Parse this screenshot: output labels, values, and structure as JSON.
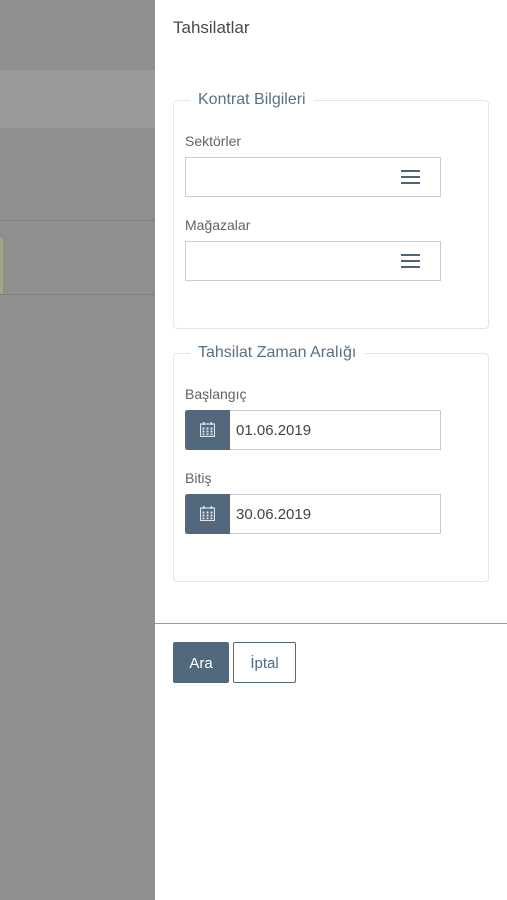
{
  "panel": {
    "title": "Tahsilatlar"
  },
  "contract_group": {
    "legend": "Kontrat Bilgileri",
    "sectors": {
      "label": "Sektörler",
      "value": "",
      "icon": "menu-icon"
    },
    "stores": {
      "label": "Mağazalar",
      "value": "",
      "icon": "menu-icon"
    }
  },
  "range_group": {
    "legend": "Tahsilat Zaman Aralığı",
    "start": {
      "label": "Başlangıç",
      "value": "01.06.2019",
      "icon": "calendar-icon"
    },
    "end": {
      "label": "Bitiş",
      "value": "30.06.2019",
      "icon": "calendar-icon"
    }
  },
  "actions": {
    "search_label": "Ara",
    "cancel_label": "İptal"
  },
  "colors": {
    "accent": "#52687d",
    "overlay": "#8e9090",
    "legend_text": "#5a7184"
  }
}
